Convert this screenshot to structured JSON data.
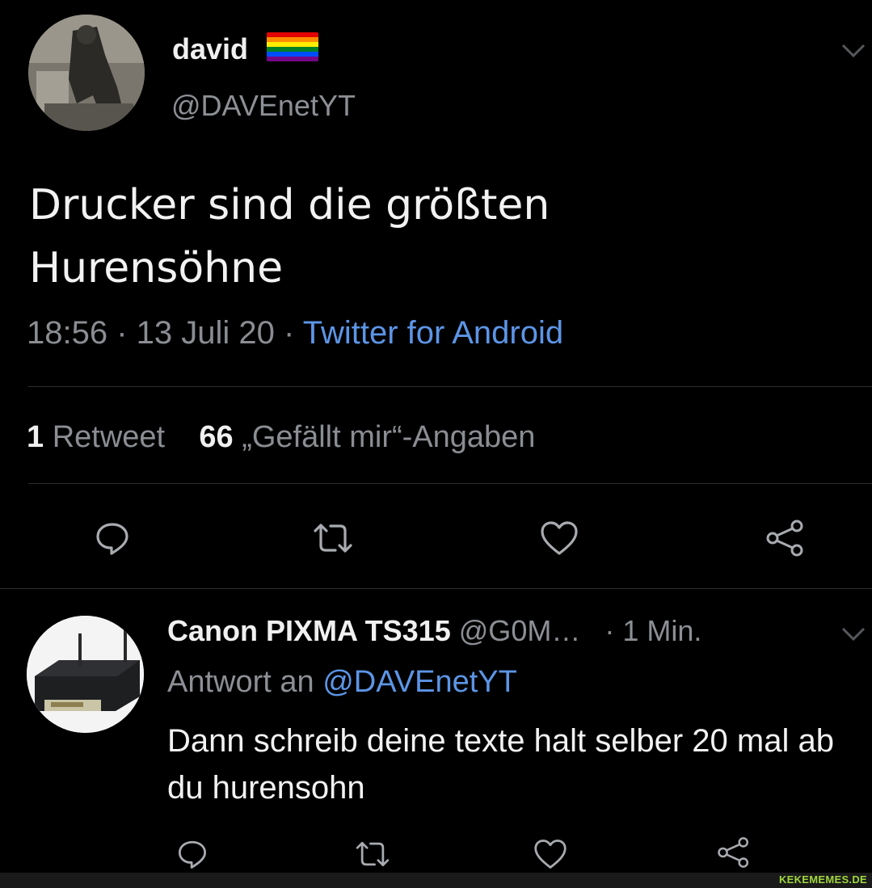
{
  "tweet": {
    "author_name": "david",
    "author_handle": "@DAVEnetYT",
    "flag_colors": [
      "#e40303",
      "#ff8c00",
      "#ffed00",
      "#008026",
      "#004dff",
      "#750787"
    ],
    "text": "Drucker sind die größten Hurensöhne",
    "time": "18:56",
    "separator": " · ",
    "date": "13 Juli 20",
    "source": "Twitter for Android",
    "retweet_count": "1",
    "retweet_label": "Retweet",
    "like_count": "66",
    "like_label": "„Gefällt mir“-Angaben",
    "actions": [
      "reply-icon",
      "retweet-icon",
      "like-icon",
      "share-icon"
    ]
  },
  "reply": {
    "author_name": "Canon PIXMA TS315",
    "author_handle": "@G0M…",
    "time": "· 1 Min.",
    "reply_prefix": "Antwort an",
    "reply_to": "@DAVEnetYT",
    "text": "Dann schreib deine texte halt selber 20 mal ab du hurensohn",
    "actions": [
      "reply-icon",
      "retweet-icon",
      "like-icon",
      "share-icon"
    ]
  },
  "watermark": "KEKEMEMES.DE",
  "colors": {
    "background": "#000000",
    "link": "#5c95e6",
    "muted": "#8a8d92",
    "watermark": "#9fd63c"
  }
}
